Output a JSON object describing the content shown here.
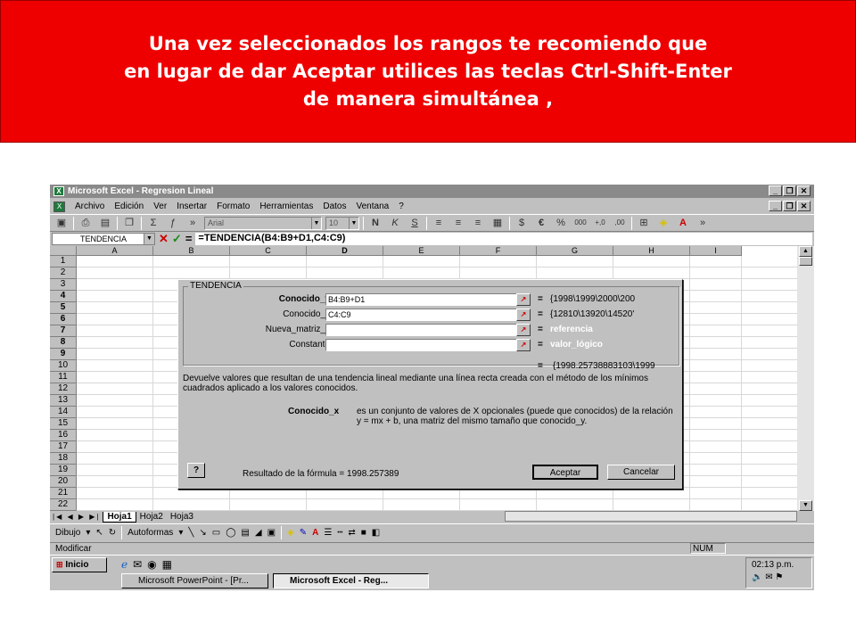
{
  "banner": {
    "line1": "Una vez seleccionados los rangos te recomiendo que",
    "line2": "en lugar de dar Aceptar utilices las teclas Ctrl-Shift-Enter",
    "line3": "de manera simultánea ,",
    "background": "#ef0000"
  },
  "window": {
    "title": "Microsoft Excel - Regresion Lineal",
    "controls": [
      "_",
      "❐",
      "✕"
    ]
  },
  "menu": [
    "Archivo",
    "Edición",
    "Ver",
    "Insertar",
    "Formato",
    "Herramientas",
    "Datos",
    "Ventana",
    "?"
  ],
  "toolbar": {
    "font": "Arial",
    "size": "10",
    "bold": "N",
    "italic": "K",
    "underline": "S",
    "currency": "€",
    "percent": "%",
    "thousands": "000",
    "inc_dec": "+,0",
    "dec_dec": ",00"
  },
  "formula_bar": {
    "name_box": "TENDENCIA",
    "cancel": "✕",
    "enter": "✓",
    "equals": "=",
    "formula": "=TENDENCIA(B4:B9+D1,C4:C9)"
  },
  "columns": [
    "A",
    "B",
    "C",
    "D",
    "E",
    "F",
    "G",
    "H",
    "I"
  ],
  "rows": [
    "1",
    "2",
    "3",
    "4",
    "5",
    "6",
    "7",
    "8",
    "9",
    "10",
    "11",
    "12",
    "13",
    "14",
    "15",
    "16",
    "17",
    "18",
    "19",
    "20",
    "21",
    "22"
  ],
  "dialog": {
    "group_title": "TENDENCIA",
    "args": [
      {
        "label": "Conocido_y",
        "value": "B4:B9+D1",
        "result": "{1998\\1999\\2000\\200",
        "bold": true,
        "hint": false
      },
      {
        "label": "Conocido_x",
        "value": "C4:C9",
        "result": "{12810\\13920\\14520'",
        "bold": false,
        "hint": false
      },
      {
        "label": "Nueva_matriz_x",
        "value": "",
        "result": "referencia",
        "bold": false,
        "hint": true
      },
      {
        "label": "Constante",
        "value": "",
        "result": "valor_lógico",
        "bold": false,
        "hint": true
      }
    ],
    "total_result": "{1998.25738883103\\1999",
    "description": "Devuelve valores que resultan de una tendencia lineal mediante una línea recta creada con el método de los mínimos cuadrados aplicado a los valores conocidos.",
    "arg_name": "Conocido_x",
    "arg_desc": "es un conjunto de valores de X opcionales (puede que conocidos) de la relación y = mx + b, una matriz del mismo tamaño que conocido_y.",
    "help": "?",
    "result_text": "Resultado de la fórmula = 1998.257389",
    "ok": "Aceptar",
    "cancel": "Cancelar"
  },
  "sheets": [
    "Hoja1",
    "Hoja2",
    "Hoja3"
  ],
  "drawing": {
    "dibujo": "Dibujo",
    "autoformas": "Autoformas"
  },
  "status": {
    "mode": "Modificar",
    "num": "NUM"
  },
  "taskbar": {
    "start": "Inicio",
    "items": [
      "Microsoft PowerPoint - [Pr...",
      "Microsoft Excel - Reg..."
    ],
    "clock": "02:13 p.m."
  }
}
